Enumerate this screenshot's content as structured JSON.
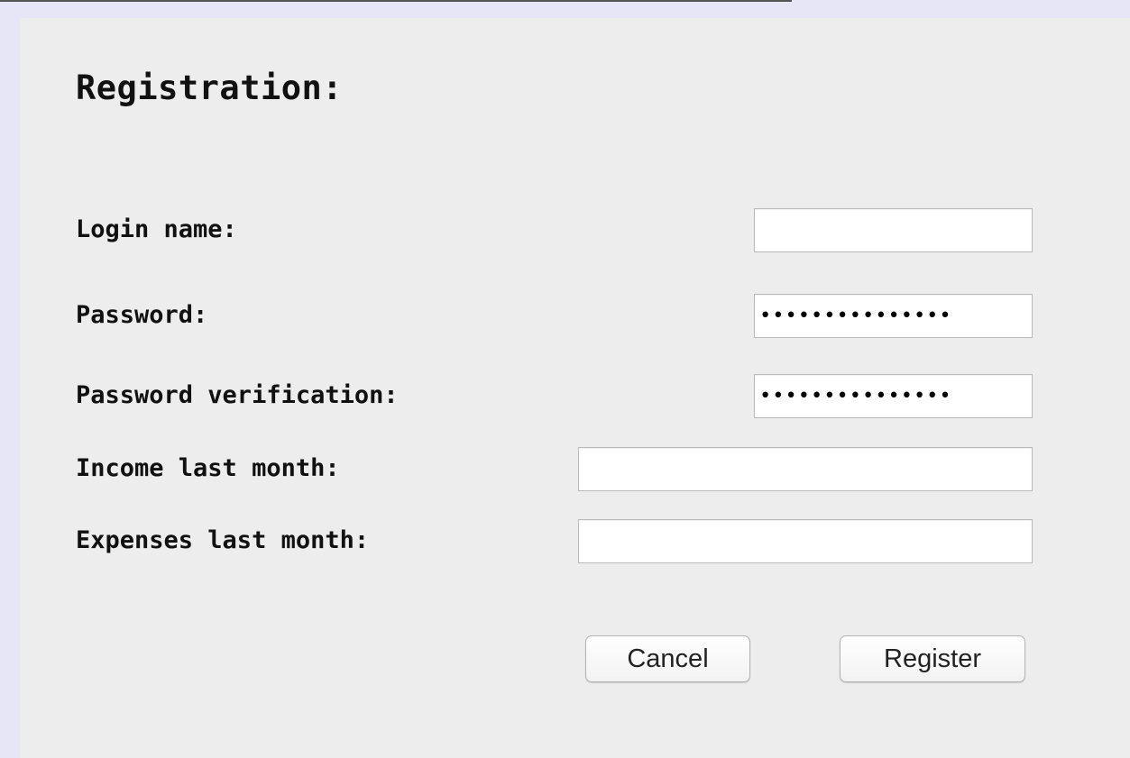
{
  "title": "Registration:",
  "fields": {
    "login_name": {
      "label": "Login name:",
      "value": ""
    },
    "password": {
      "label": "Password:",
      "value": "•••••••••••••••"
    },
    "password_verification": {
      "label": "Password verification:",
      "value": "•••••••••••••••"
    },
    "income_last_month": {
      "label": "Income last month:",
      "value": ""
    },
    "expenses_last_month": {
      "label": "Expenses last month:",
      "value": ""
    }
  },
  "buttons": {
    "cancel": "Cancel",
    "register": "Register"
  },
  "colors": {
    "window_background": "#ededed",
    "outer_background": "#e6e6f7",
    "field_background": "#ffffff"
  }
}
